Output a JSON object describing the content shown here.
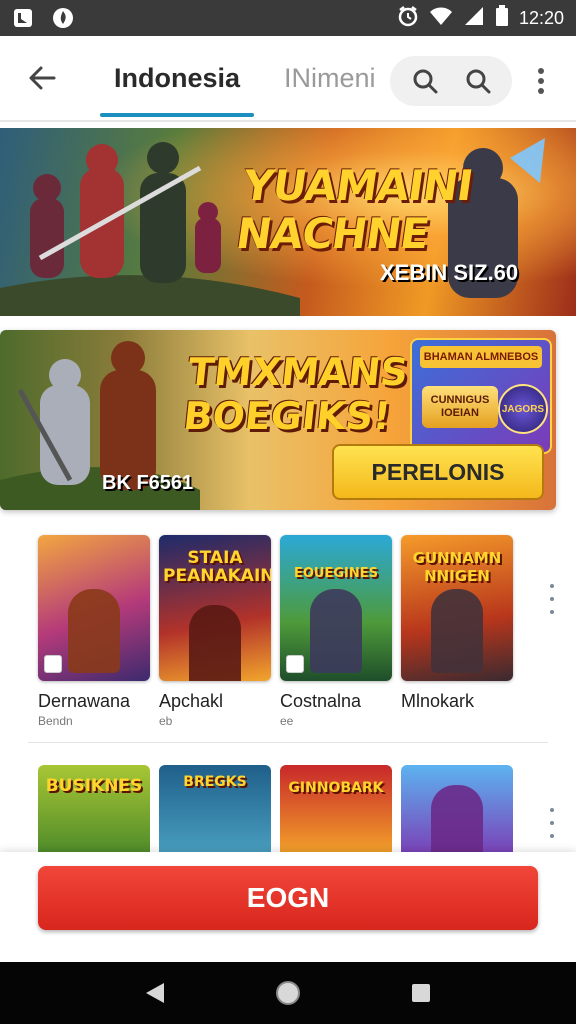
{
  "status_bar": {
    "time": "12:20"
  },
  "app_bar": {
    "tabs": [
      {
        "label": "Indonesia",
        "active": true
      },
      {
        "label": "INimeni",
        "active": false
      }
    ]
  },
  "banner_1": {
    "title": "YUAMAINI NACHNE",
    "subtitle": "XEBIN SIZ.60"
  },
  "banner_2": {
    "title": "TMXMANS BOEGIKS!",
    "footer": "BK F6561",
    "mini_header": "BHAMAN ALMNEBOS",
    "mini_left": "CUNNIGUS IOEIAN",
    "mini_right": "JAGORS",
    "button_label": "PERELONIS"
  },
  "games_row_1": [
    {
      "thumb_title": "",
      "name": "Dernawana",
      "sub": "Bendn",
      "colors": [
        "#f2a640",
        "#b43a7a",
        "#3c2a6e"
      ]
    },
    {
      "thumb_title": "STAIA PEANAKAIN",
      "name": "Apchakl",
      "sub": "eb",
      "colors": [
        "#1d2b6b",
        "#b2322a",
        "#f2a52d"
      ]
    },
    {
      "thumb_title": "EOUEGINES",
      "name": "Costnalna",
      "sub": "ee",
      "colors": [
        "#2ba9d6",
        "#4e9a3a",
        "#1f4e2a"
      ]
    },
    {
      "thumb_title": "GUNNAMN NNIGEN",
      "name": "Mlnokark",
      "sub": "",
      "colors": [
        "#f59b2a",
        "#b8361c",
        "#3a2a30"
      ]
    }
  ],
  "games_row_2": [
    {
      "thumb_title": "BUSIKNES",
      "colors": [
        "#a8c634",
        "#4d8a2a"
      ]
    },
    {
      "thumb_title": "BREGKS",
      "colors": [
        "#1f5f8a",
        "#4aa0c0"
      ]
    },
    {
      "thumb_title": "GINNOBARK",
      "colors": [
        "#c8282a",
        "#f3a32a"
      ]
    },
    {
      "thumb_title": "",
      "colors": [
        "#5db3f0",
        "#7b3fb6"
      ]
    }
  ],
  "cta": {
    "label": "EOGN"
  },
  "colors": {
    "accent": "#1b8fc0",
    "cta": "#e0302a",
    "banner_button": "#f6c72d"
  }
}
